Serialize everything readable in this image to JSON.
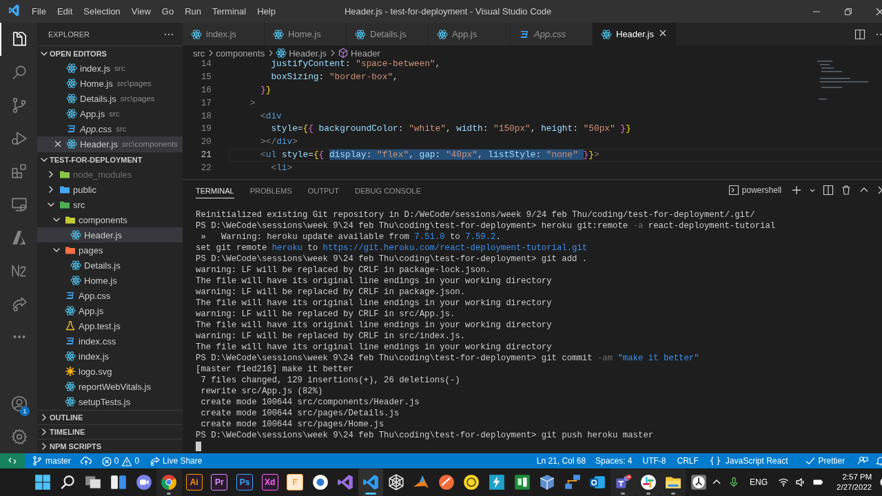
{
  "window": {
    "title": "Header.js - test-for-deployment - Visual Studio Code",
    "menu": [
      "File",
      "Edit",
      "Selection",
      "View",
      "Go",
      "Run",
      "Terminal",
      "Help"
    ]
  },
  "activity_bar": {
    "items": [
      {
        "kind": "explorer",
        "selected": true
      },
      {
        "kind": "search",
        "selected": false
      },
      {
        "kind": "source-control",
        "selected": false
      },
      {
        "kind": "debug",
        "selected": false
      },
      {
        "kind": "extensions",
        "selected": false
      },
      {
        "kind": "remote",
        "selected": false
      },
      {
        "kind": "azure",
        "selected": false
      },
      {
        "kind": "zigzag",
        "selected": false
      },
      {
        "kind": "live-share",
        "selected": false
      },
      {
        "kind": "more",
        "selected": false
      }
    ],
    "accounts_badge": "1"
  },
  "sidebar": {
    "title": "EXPLORER",
    "open_editors": {
      "title": "OPEN EDITORS",
      "expanded": true,
      "items": [
        {
          "name": "index.js",
          "path": "src",
          "kind": "react",
          "preview": false,
          "selected": false
        },
        {
          "name": "Home.js",
          "path": "src\\pages",
          "kind": "react",
          "preview": false,
          "selected": false
        },
        {
          "name": "Details.js",
          "path": "src\\pages",
          "kind": "react",
          "preview": false,
          "selected": false
        },
        {
          "name": "App.js",
          "path": "src",
          "kind": "react",
          "preview": false,
          "selected": false
        },
        {
          "name": "App.css",
          "path": "src",
          "kind": "css",
          "preview": true,
          "selected": false
        },
        {
          "name": "Header.js",
          "path": "src\\components",
          "kind": "react",
          "preview": false,
          "selected": true
        }
      ]
    },
    "project": {
      "title": "TEST-FOR-DEPLOYMENT",
      "expanded": true,
      "tree": [
        {
          "name": "node_modules",
          "kind": "folder",
          "color": "#8bc34a",
          "expanded": false,
          "ignored": true,
          "selected": false
        },
        {
          "name": "public",
          "kind": "folder",
          "color": "#42a5f5",
          "expanded": false,
          "ignored": false,
          "selected": false
        },
        {
          "name": "src",
          "kind": "folder",
          "color": "#4caf50",
          "expanded": true,
          "ignored": false,
          "selected": false,
          "children": [
            {
              "name": "components",
              "kind": "folder",
              "color": "#c0ca33",
              "expanded": true,
              "ignored": false,
              "selected": false,
              "children": [
                {
                  "name": "Header.js",
                  "kind": "react",
                  "ignored": false,
                  "selected": true
                }
              ]
            },
            {
              "name": "pages",
              "kind": "folder",
              "color": "#ff7043",
              "expanded": true,
              "ignored": false,
              "selected": false,
              "children": [
                {
                  "name": "Details.js",
                  "kind": "react",
                  "ignored": false,
                  "selected": false
                },
                {
                  "name": "Home.js",
                  "kind": "react",
                  "ignored": false,
                  "selected": false
                }
              ]
            },
            {
              "name": "App.css",
              "kind": "css",
              "ignored": false,
              "selected": false
            },
            {
              "name": "App.js",
              "kind": "react",
              "ignored": false,
              "selected": false
            },
            {
              "name": "App.test.js",
              "kind": "test",
              "ignored": false,
              "selected": false
            },
            {
              "name": "index.css",
              "kind": "css",
              "ignored": false,
              "selected": false
            },
            {
              "name": "index.js",
              "kind": "react",
              "ignored": false,
              "selected": false
            },
            {
              "name": "logo.svg",
              "kind": "svg",
              "ignored": false,
              "selected": false
            },
            {
              "name": "reportWebVitals.js",
              "kind": "react",
              "ignored": false,
              "selected": false
            },
            {
              "name": "setupTests.js",
              "kind": "react",
              "ignored": false,
              "selected": false
            }
          ]
        }
      ]
    },
    "sections": [
      {
        "title": "OUTLINE",
        "expanded": false
      },
      {
        "title": "TIMELINE",
        "expanded": false
      },
      {
        "title": "NPM SCRIPTS",
        "expanded": false
      }
    ]
  },
  "editor": {
    "tabs": [
      {
        "label": "index.js",
        "kind": "react",
        "preview": false,
        "selected": false
      },
      {
        "label": "Home.js",
        "kind": "react",
        "preview": false,
        "selected": false
      },
      {
        "label": "Details.js",
        "kind": "react",
        "preview": false,
        "selected": false
      },
      {
        "label": "App.js",
        "kind": "react",
        "preview": false,
        "selected": false
      },
      {
        "label": "App.css",
        "kind": "css",
        "preview": true,
        "selected": false
      },
      {
        "label": "Header.js",
        "kind": "react",
        "preview": false,
        "selected": true
      }
    ],
    "breadcrumb": [
      {
        "text": "src",
        "kind": "folder"
      },
      {
        "text": "components",
        "kind": "folder"
      },
      {
        "text": "Header.js",
        "kind": "react"
      },
      {
        "text": "Header",
        "kind": "symbol"
      }
    ],
    "lines": [
      {
        "number": "14",
        "current": false,
        "tokens": [
          {
            "t": "        justifyContent",
            "kind": "prop"
          },
          {
            "t": ": ",
            "kind": "text"
          },
          {
            "t": "\"space-between\"",
            "kind": "str"
          },
          {
            "t": ",",
            "kind": "text"
          }
        ]
      },
      {
        "number": "15",
        "current": false,
        "tokens": [
          {
            "t": "        boxSizing",
            "kind": "prop"
          },
          {
            "t": ": ",
            "kind": "text"
          },
          {
            "t": "\"border-box\"",
            "kind": "str"
          },
          {
            "t": ",",
            "kind": "text"
          }
        ]
      },
      {
        "number": "16",
        "current": false,
        "tokens": [
          {
            "t": "      }",
            "kind": "brace2"
          },
          {
            "t": "}",
            "kind": "brace"
          }
        ]
      },
      {
        "number": "17",
        "current": false,
        "tokens": [
          {
            "t": "    >",
            "kind": "punct"
          }
        ]
      },
      {
        "number": "18",
        "current": false,
        "tokens": [
          {
            "t": "      <",
            "kind": "punct"
          },
          {
            "t": "div",
            "kind": "tag"
          }
        ]
      },
      {
        "number": "19",
        "current": false,
        "tokens": [
          {
            "t": "        style",
            "kind": "prop"
          },
          {
            "t": "=",
            "kind": "text"
          },
          {
            "t": "{",
            "kind": "brace"
          },
          {
            "t": "{ ",
            "kind": "brace2"
          },
          {
            "t": "backgroundColor",
            "kind": "prop"
          },
          {
            "t": ": ",
            "kind": "text"
          },
          {
            "t": "\"white\"",
            "kind": "str"
          },
          {
            "t": ", ",
            "kind": "text"
          },
          {
            "t": "width",
            "kind": "prop"
          },
          {
            "t": ": ",
            "kind": "text"
          },
          {
            "t": "\"150px\"",
            "kind": "str"
          },
          {
            "t": ", ",
            "kind": "text"
          },
          {
            "t": "height",
            "kind": "prop"
          },
          {
            "t": ": ",
            "kind": "text"
          },
          {
            "t": "\"50px\" ",
            "kind": "str"
          },
          {
            "t": "}",
            "kind": "brace2"
          },
          {
            "t": "}",
            "kind": "brace"
          }
        ]
      },
      {
        "number": "20",
        "current": false,
        "tokens": [
          {
            "t": "      ></",
            "kind": "punct"
          },
          {
            "t": "div",
            "kind": "tag"
          },
          {
            "t": ">",
            "kind": "punct"
          }
        ]
      },
      {
        "number": "21",
        "current": true,
        "tokens": [
          {
            "t": "      <",
            "kind": "punct",
            "selected": false
          },
          {
            "t": "ul",
            "kind": "tag",
            "selected": false
          },
          {
            "t": " style",
            "kind": "prop",
            "selected": false
          },
          {
            "t": "=",
            "kind": "text",
            "selected": false
          },
          {
            "t": "{",
            "kind": "brace",
            "selected": false
          },
          {
            "t": "{ ",
            "kind": "brace2",
            "selected": false
          },
          {
            "t": "display",
            "kind": "prop",
            "selected": true
          },
          {
            "t": ": ",
            "kind": "text",
            "selected": true
          },
          {
            "t": "\"flex\"",
            "kind": "str",
            "selected": true
          },
          {
            "t": ", ",
            "kind": "text",
            "selected": true
          },
          {
            "t": "gap",
            "kind": "prop",
            "selected": true
          },
          {
            "t": ": ",
            "kind": "text",
            "selected": true
          },
          {
            "t": "\"40px\"",
            "kind": "str",
            "selected": true
          },
          {
            "t": ", ",
            "kind": "text",
            "selected": true
          },
          {
            "t": "listStyle",
            "kind": "prop",
            "selected": true
          },
          {
            "t": ": ",
            "kind": "text",
            "selected": true
          },
          {
            "t": "\"none\" ",
            "kind": "str",
            "selected": true
          },
          {
            "t": "}",
            "kind": "brace2",
            "selected": false
          },
          {
            "t": "}",
            "kind": "brace",
            "selected": false
          },
          {
            "t": ">",
            "kind": "punct",
            "selected": false
          }
        ]
      },
      {
        "number": "22",
        "current": false,
        "tokens": [
          {
            "t": "        <",
            "kind": "punct"
          },
          {
            "t": "li",
            "kind": "tag"
          },
          {
            "t": ">",
            "kind": "punct"
          }
        ]
      }
    ]
  },
  "panel": {
    "tabs": [
      {
        "label": "TERMINAL",
        "selected": true
      },
      {
        "label": "PROBLEMS",
        "selected": false
      },
      {
        "label": "OUTPUT",
        "selected": false
      },
      {
        "label": "DEBUG CONSOLE",
        "selected": false
      }
    ],
    "shell": "powershell",
    "lines": [
      [
        {
          "t": "Reinitialized existing Git repository in D:/WeCode/sessions/week 9/24 feb Thu/coding/test-for-deployment/.git/",
          "kind": "out"
        }
      ],
      [
        {
          "t": "PS D:\\WeCode\\sessions\\week 9\\24 feb Thu\\coding\\test-for-deployment> heroku git:remote ",
          "kind": "out"
        },
        {
          "t": "-a",
          "kind": "flag"
        },
        {
          "t": " react-deployment-tutorial",
          "kind": "out"
        }
      ],
      [
        {
          "t": " »   Warning: heroku update available from ",
          "kind": "out"
        },
        {
          "t": "7.51.0",
          "kind": "num"
        },
        {
          "t": " to ",
          "kind": "out"
        },
        {
          "t": "7.59.2",
          "kind": "num"
        },
        {
          "t": ".",
          "kind": "out"
        }
      ],
      [
        {
          "t": "set git remote ",
          "kind": "out"
        },
        {
          "t": "heroku",
          "kind": "num"
        },
        {
          "t": " to ",
          "kind": "out"
        },
        {
          "t": "https://git.heroku.com/react-deployment-tutorial.git",
          "kind": "link"
        }
      ],
      [
        {
          "t": "PS D:\\WeCode\\sessions\\week 9\\24 feb Thu\\coding\\test-for-deployment> git add .",
          "kind": "out"
        }
      ],
      [
        {
          "t": "warning: LF will be replaced by CRLF in package-lock.json.",
          "kind": "out"
        }
      ],
      [
        {
          "t": "The file will have its original line endings in your working directory",
          "kind": "out"
        }
      ],
      [
        {
          "t": "warning: LF will be replaced by CRLF in package.json.",
          "kind": "out"
        }
      ],
      [
        {
          "t": "The file will have its original line endings in your working directory",
          "kind": "out"
        }
      ],
      [
        {
          "t": "warning: LF will be replaced by CRLF in src/App.js.",
          "kind": "out"
        }
      ],
      [
        {
          "t": "The file will have its original line endings in your working directory",
          "kind": "out"
        }
      ],
      [
        {
          "t": "warning: LF will be replaced by CRLF in src/index.js.",
          "kind": "out"
        }
      ],
      [
        {
          "t": "The file will have its original line endings in your working directory",
          "kind": "out"
        }
      ],
      [
        {
          "t": "PS D:\\WeCode\\sessions\\week 9\\24 feb Thu\\coding\\test-for-deployment> git commit ",
          "kind": "out"
        },
        {
          "t": "-am",
          "kind": "flag"
        },
        {
          "t": " \"make it better\"",
          "kind": "str"
        }
      ],
      [
        {
          "t": "[master f1ed216] make it better",
          "kind": "out"
        }
      ],
      [
        {
          "t": " 7 files changed, 129 insertions(+), 26 deletions(-)",
          "kind": "out"
        }
      ],
      [
        {
          "t": " rewrite src/App.js (82%)",
          "kind": "out"
        }
      ],
      [
        {
          "t": " create mode 100644 src/components/Header.js",
          "kind": "out"
        }
      ],
      [
        {
          "t": " create mode 100644 src/pages/Details.js",
          "kind": "out"
        }
      ],
      [
        {
          "t": " create mode 100644 src/pages/Home.js",
          "kind": "out"
        }
      ],
      [
        {
          "t": "PS D:\\WeCode\\sessions\\week 9\\24 feb Thu\\coding\\test-for-deployment> git push heroku master",
          "kind": "out"
        }
      ]
    ]
  },
  "status_bar": {
    "branch": "master",
    "errors": "0",
    "warnings": "0",
    "live_share": "Live Share",
    "position": "Ln 21, Col 68",
    "indentation": "Spaces: 4",
    "encoding": "UTF-8",
    "eol": "CRLF",
    "language": "JavaScript React",
    "formatter": "Prettier"
  },
  "taskbar": {
    "apps": [
      {
        "kind": "start",
        "running": false,
        "active": false
      },
      {
        "kind": "search",
        "running": false,
        "active": false
      },
      {
        "kind": "task-view",
        "running": false,
        "active": false
      },
      {
        "kind": "widgets",
        "running": false,
        "active": false
      },
      {
        "kind": "chat",
        "running": false,
        "active": false
      },
      {
        "kind": "chrome",
        "running": true,
        "active": false
      },
      {
        "kind": "tile",
        "label": "Ai",
        "color": "#ff9a00",
        "running": false,
        "active": false
      },
      {
        "kind": "tile",
        "label": "Pr",
        "color": "#d291ff",
        "running": false,
        "active": false
      },
      {
        "kind": "tile",
        "label": "Ps",
        "color": "#31a8ff",
        "running": false,
        "active": false
      },
      {
        "kind": "tile",
        "label": "Xd",
        "color": "#ff61f6",
        "running": false,
        "active": false
      },
      {
        "kind": "tile",
        "label": "F",
        "color": "#f7a440",
        "running": false,
        "active": false
      },
      {
        "kind": "circle-app",
        "running": false,
        "active": false
      },
      {
        "kind": "visual-studio",
        "running": false,
        "active": false
      },
      {
        "kind": "vscode",
        "running": true,
        "active": true
      },
      {
        "kind": "web",
        "running": false,
        "active": false
      },
      {
        "kind": "peak",
        "running": false,
        "active": false
      },
      {
        "kind": "orange-disc",
        "running": false,
        "active": false
      },
      {
        "kind": "yellow-disc",
        "running": false,
        "active": false
      },
      {
        "kind": "bolt",
        "running": false,
        "active": false
      },
      {
        "kind": "translator",
        "running": false,
        "active": false
      },
      {
        "kind": "cube",
        "running": false,
        "active": false
      },
      {
        "kind": "network",
        "running": false,
        "active": false
      },
      {
        "kind": "mail",
        "running": false,
        "active": false
      },
      {
        "kind": "teams",
        "running": true,
        "active": false
      },
      {
        "kind": "slack",
        "running": true,
        "active": false
      },
      {
        "kind": "folder",
        "running": true,
        "active": false
      },
      {
        "kind": "clock",
        "running": false,
        "active": false
      }
    ],
    "language": "ENG",
    "time": "2:57 PM",
    "date": "2/27/2022"
  }
}
